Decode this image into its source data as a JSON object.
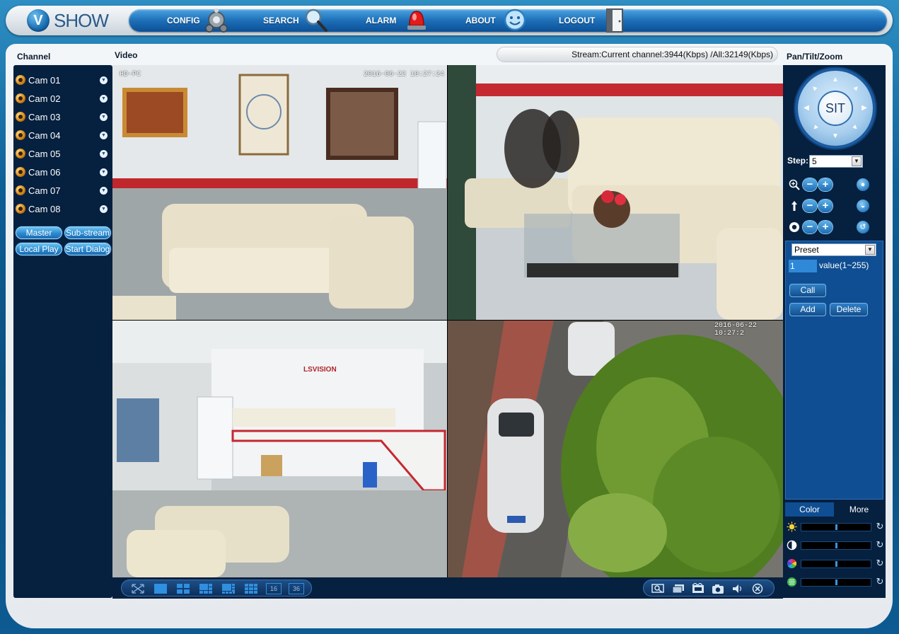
{
  "app": {
    "logo_letter": "V",
    "logo_text": "SHOW"
  },
  "nav": {
    "config": "CONFIG",
    "search": "SEARCH",
    "alarm": "ALARM",
    "about": "ABOUT",
    "logout": "LOGOUT"
  },
  "headers": {
    "channel": "Channel",
    "video": "Video",
    "ptz": "Pan/Tilt/Zoom"
  },
  "stream_info": "Stream:Current channel:3944(Kbps) /All:32149(Kbps)",
  "channels": [
    {
      "label": "Cam 01"
    },
    {
      "label": "Cam 02"
    },
    {
      "label": "Cam 03"
    },
    {
      "label": "Cam 04"
    },
    {
      "label": "Cam 05"
    },
    {
      "label": "Cam 06"
    },
    {
      "label": "Cam 07"
    },
    {
      "label": "Cam 08"
    }
  ],
  "channel_buttons": {
    "master": "Master",
    "sub_stream": "Sub-stream",
    "local_play": "Local Play",
    "start_dialog": "Start Dialog"
  },
  "videos": [
    {
      "osd_name": "HD-PC",
      "osd_time": "2016-06-22 10:27:24"
    },
    {
      "osd_name": "",
      "osd_time": ""
    },
    {
      "osd_name": "",
      "osd_time": ""
    },
    {
      "osd_name": "",
      "osd_time": "2016-06-22 10:27:2"
    }
  ],
  "ptz": {
    "center_label": "SIT",
    "step_label": "Step:",
    "step_value": "5",
    "preset_select": "Preset",
    "preset_value": "1",
    "preset_range": "value(1~255)",
    "call": "Call",
    "add": "Add",
    "delete": "Delete",
    "minus": "−",
    "plus": "+"
  },
  "color_tabs": {
    "color": "Color",
    "more": "More"
  },
  "sliders": [
    {
      "name": "brightness",
      "level": 0.5
    },
    {
      "name": "contrast",
      "level": 0.5
    },
    {
      "name": "saturation",
      "level": 0.5
    },
    {
      "name": "hue",
      "level": 0.5
    }
  ],
  "toolbar_labels": {
    "split16": "16",
    "split36": "36"
  },
  "colors": {
    "accent": "#1d6fb8",
    "panel_dark": "#06203f",
    "ptz_blue": "#0f4e92"
  }
}
